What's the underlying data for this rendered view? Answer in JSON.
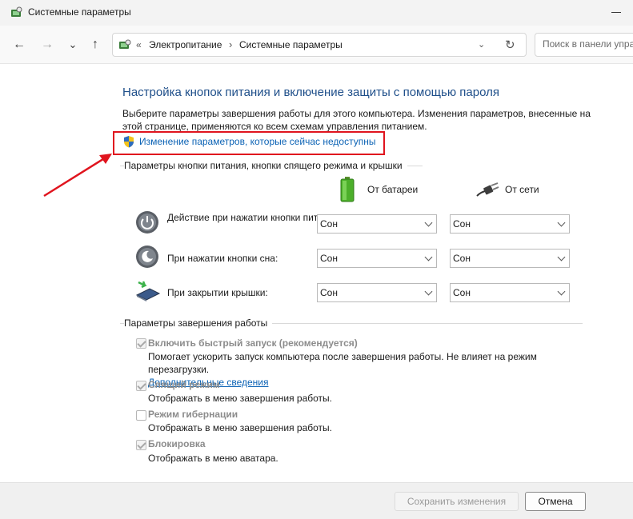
{
  "window": {
    "title": "Системные параметры"
  },
  "nav": {
    "back_glyph": "←",
    "forward_glyph": "→",
    "recent_glyph": "⌄",
    "up_glyph": "↑",
    "address_prefix": "«",
    "breadcrumbs": [
      "Электропитание",
      "Системные параметры"
    ],
    "breadcrumb_sep": "›",
    "search_placeholder": "Поиск в панели упра"
  },
  "page": {
    "heading": "Настройка кнопок питания и включение защиты с помощью пароля",
    "description": "Выберите параметры завершения работы для этого компьютера. Изменения параметров, внесенные на этой странице, применяются ко всем схемам управления питанием.",
    "change_link": "Изменение параметров, которые сейчас недоступны",
    "highlight_color": "#e0141e"
  },
  "buttons_section": {
    "title": "Параметры кнопки питания, кнопки спящего режима и крышки",
    "col_battery": "От батареи",
    "col_ac": "От сети",
    "rows": [
      {
        "label": "Действие при нажатии кнопки питания:",
        "icon": "power-button-icon",
        "battery": "Сон",
        "ac": "Сон"
      },
      {
        "label": "При нажатии кнопки сна:",
        "icon": "sleep-button-icon",
        "battery": "Сон",
        "ac": "Сон"
      },
      {
        "label": "При закрытии крышки:",
        "icon": "laptop-lid-icon",
        "battery": "Сон",
        "ac": "Сон"
      }
    ]
  },
  "shutdown_section": {
    "title": "Параметры завершения работы",
    "options": [
      {
        "label": "Включить быстрый запуск (рекомендуется)",
        "desc": "Помогает ускорить запуск компьютера после завершения работы. Не влияет на режим перезагрузки.",
        "link": "Дополнительные сведения",
        "checked": true
      },
      {
        "label": "Спящий режим",
        "desc": "Отображать в меню завершения работы.",
        "checked": true
      },
      {
        "label": "Режим гибернации",
        "desc": "Отображать в меню завершения работы.",
        "checked": false
      },
      {
        "label": "Блокировка",
        "desc": "Отображать в меню аватара.",
        "checked": true
      }
    ]
  },
  "footer": {
    "save_label": "Сохранить изменения",
    "cancel_label": "Отмена"
  }
}
